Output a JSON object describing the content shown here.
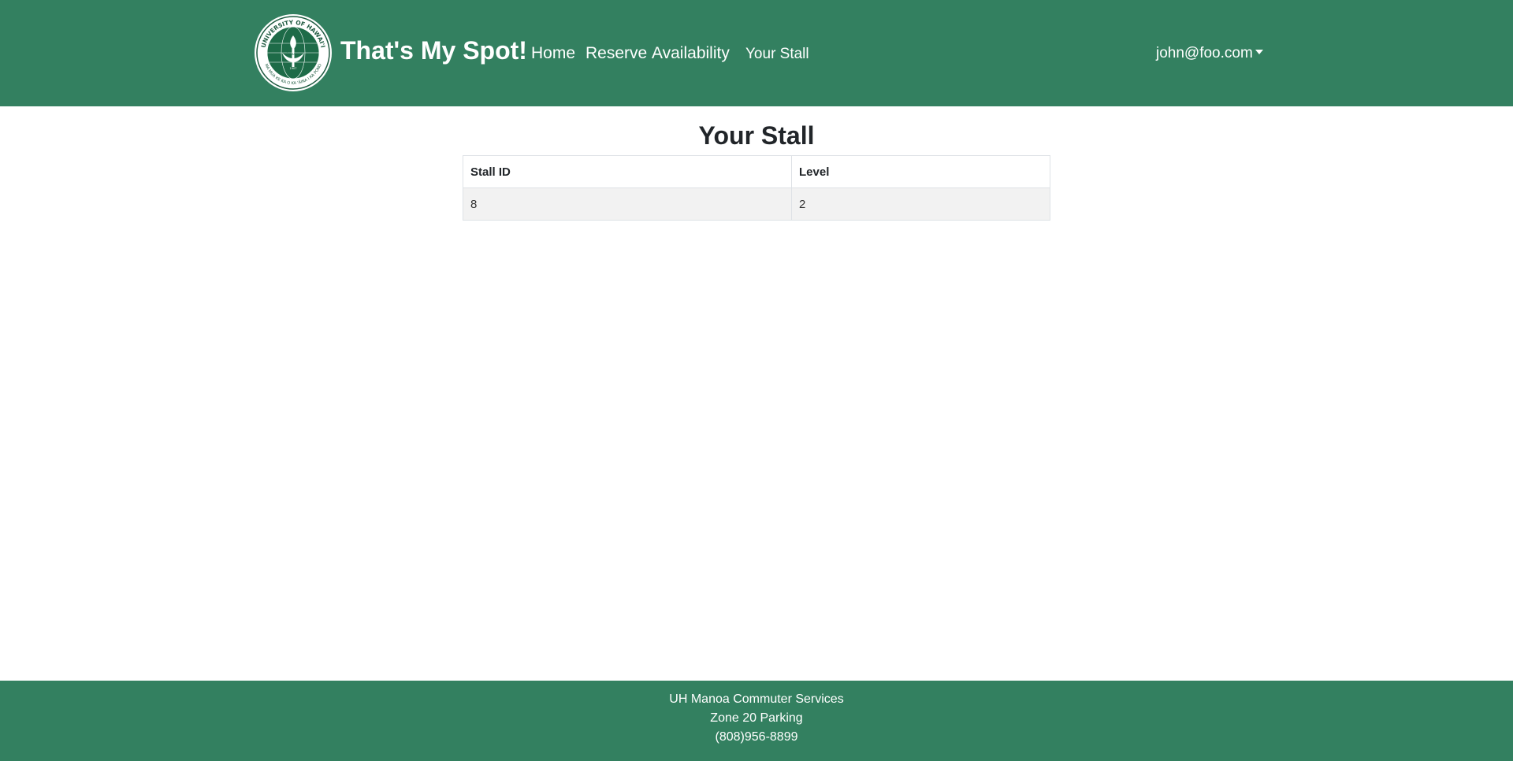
{
  "navbar": {
    "brand": "That's My Spot!",
    "links": [
      "Home",
      "Reserve",
      "Availability",
      "Your Stall"
    ],
    "user": "john@foo.com",
    "logo_text": "UNIVERSITY OF HAWAI'I",
    "logo_motto": "MA MUA KE KA O KA 'ĀINA I KA PONO",
    "logo_center": "MĀLAMALAMA",
    "logo_year": "1907"
  },
  "main": {
    "title": "Your Stall",
    "table": {
      "headers": [
        "Stall ID",
        "Level"
      ],
      "rows": [
        [
          "8",
          "2"
        ]
      ]
    }
  },
  "footer": {
    "lines": [
      "UH Manoa Commuter Services",
      "Zone 20 Parking",
      "(808)956-8899"
    ]
  },
  "colors": {
    "primary": "#338060",
    "row_bg": "#f2f2f2"
  }
}
